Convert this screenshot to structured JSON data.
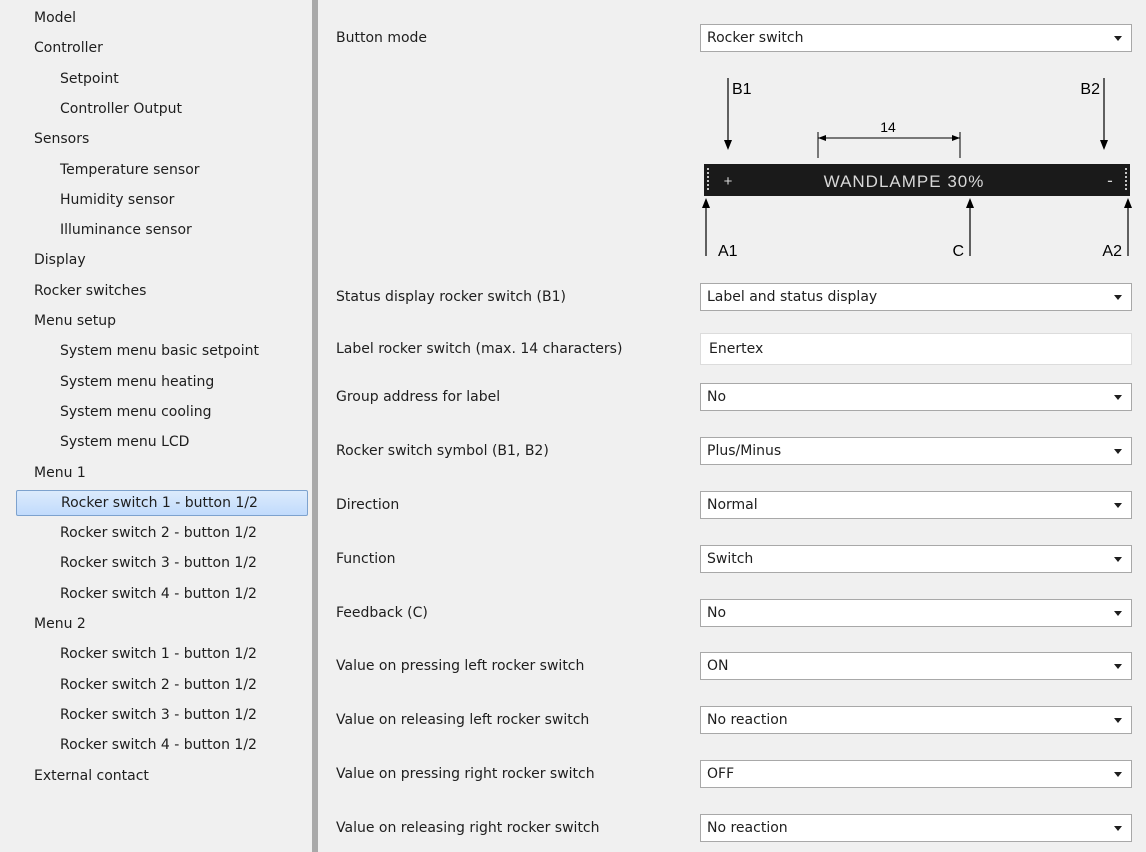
{
  "sidebar": {
    "items": [
      {
        "label": "Model",
        "level": 0
      },
      {
        "label": "Controller",
        "level": 0
      },
      {
        "label": "Setpoint",
        "level": 1
      },
      {
        "label": "Controller Output",
        "level": 1
      },
      {
        "label": "Sensors",
        "level": 0
      },
      {
        "label": "Temperature sensor",
        "level": 1
      },
      {
        "label": "Humidity sensor",
        "level": 1
      },
      {
        "label": "Illuminance sensor",
        "level": 1
      },
      {
        "label": "Display",
        "level": 0
      },
      {
        "label": "Rocker switches",
        "level": 0
      },
      {
        "label": "Menu setup",
        "level": 0
      },
      {
        "label": "System menu basic setpoint",
        "level": 1
      },
      {
        "label": "System menu heating",
        "level": 1
      },
      {
        "label": "System menu cooling",
        "level": 1
      },
      {
        "label": "System menu LCD",
        "level": 1
      },
      {
        "label": "Menu 1",
        "level": 0
      },
      {
        "label": "Rocker switch 1 - button 1/2",
        "level": 1,
        "selected": true
      },
      {
        "label": "Rocker switch 2 - button 1/2",
        "level": 1
      },
      {
        "label": "Rocker switch 3 - button 1/2",
        "level": 1
      },
      {
        "label": "Rocker switch 4 - button 1/2",
        "level": 1
      },
      {
        "label": "Menu 2",
        "level": 0
      },
      {
        "label": "Rocker switch 1 - button 1/2",
        "level": 1
      },
      {
        "label": "Rocker switch 2 - button 1/2",
        "level": 1
      },
      {
        "label": "Rocker switch 3 - button 1/2",
        "level": 1
      },
      {
        "label": "Rocker switch 4 - button 1/2",
        "level": 1
      },
      {
        "label": "External contact",
        "level": 0
      }
    ]
  },
  "params": {
    "button_mode": {
      "label": "Button mode",
      "value": "Rocker switch"
    },
    "status_display": {
      "label": "Status display rocker switch (B1)",
      "value": "Label and status display"
    },
    "label_rocker": {
      "label": "Label rocker switch (max. 14 characters)",
      "value": "Enertex"
    },
    "group_address": {
      "label": "Group address for label",
      "value": "No"
    },
    "symbol": {
      "label": "Rocker switch symbol (B1, B2)",
      "value": "Plus/Minus"
    },
    "direction": {
      "label": "Direction",
      "value": "Normal"
    },
    "function": {
      "label": "Function",
      "value": "Switch"
    },
    "feedback": {
      "label": "Feedback (C)",
      "value": "No"
    },
    "press_left": {
      "label": "Value on pressing left rocker switch",
      "value": "ON"
    },
    "release_left": {
      "label": "Value on releasing left rocker switch",
      "value": "No reaction"
    },
    "press_right": {
      "label": "Value on pressing right rocker switch",
      "value": "OFF"
    },
    "release_right": {
      "label": "Value on releasing right rocker switch",
      "value": "No reaction"
    }
  },
  "diagram": {
    "b1": "B1",
    "b2": "B2",
    "width_label": "14",
    "display_text": "WANDLAMPE 30%",
    "plus": "+",
    "minus": "-",
    "a1": "A1",
    "a2": "A2",
    "c": "C"
  },
  "colors": {
    "selection": "#c9dffc",
    "display_bg": "#1a1a1a",
    "display_text": "#d8d8d8"
  }
}
